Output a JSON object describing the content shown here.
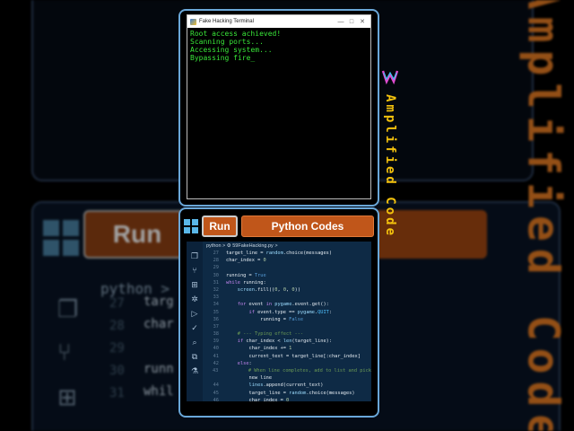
{
  "terminal": {
    "title": "Fake Hacking Terminal",
    "controls": [
      "—",
      "□",
      "✕"
    ],
    "lines": [
      "Root access achieved!",
      "Scanning ports...",
      "Accessing system...",
      "Bypassing fire_"
    ]
  },
  "header": {
    "run_label": "Run",
    "title": "Python Codes"
  },
  "editor": {
    "breadcrumb": "python > ⚙ 59FakeHacking.py >",
    "lines": [
      {
        "n": "27",
        "t": "target_line = random.choice(messages)"
      },
      {
        "n": "28",
        "t": "char_index = 0"
      },
      {
        "n": "29",
        "t": ""
      },
      {
        "n": "30",
        "t": "running = True"
      },
      {
        "n": "31",
        "t": "while running:"
      },
      {
        "n": "32",
        "t": "    screen.fill((0, 0, 0))"
      },
      {
        "n": "33",
        "t": ""
      },
      {
        "n": "34",
        "t": "    for event in pygame.event.get():"
      },
      {
        "n": "35",
        "t": "        if event.type == pygame.QUIT:"
      },
      {
        "n": "36",
        "t": "            running = False"
      },
      {
        "n": "37",
        "t": ""
      },
      {
        "n": "38",
        "t": "    # --- Typing effect ---"
      },
      {
        "n": "39",
        "t": "    if char_index < len(target_line):"
      },
      {
        "n": "40",
        "t": "        char_index += 1"
      },
      {
        "n": "41",
        "t": "        current_text = target_line[:char_index]"
      },
      {
        "n": "42",
        "t": "    else:"
      },
      {
        "n": "43",
        "t": "        # When line completes, add to list and pick"
      },
      {
        "n": "",
        "t": "        new line"
      },
      {
        "n": "44",
        "t": "        lines.append(current_text)"
      },
      {
        "n": "45",
        "t": "        target_line = random.choice(messages)"
      },
      {
        "n": "46",
        "t": "        char_index = 0"
      }
    ]
  },
  "brand": {
    "text": "Amplified Code",
    "colors": {
      "accent": "#f4c20d",
      "run": "#c0561a",
      "frame": "#6aa7d8"
    }
  },
  "background": {
    "run_label": "Run",
    "python_label": "python >",
    "line_numbers": [
      "27",
      "28",
      "29",
      "30",
      "31"
    ],
    "code": [
      "targ",
      "char",
      "",
      "runn",
      "whil"
    ],
    "vertical_text": "Amplified Code"
  },
  "icons": [
    "windows-logo-icon",
    "files-icon",
    "source-control-icon",
    "extensions-icon",
    "run-debug-icon",
    "search-icon",
    "test-icon"
  ]
}
